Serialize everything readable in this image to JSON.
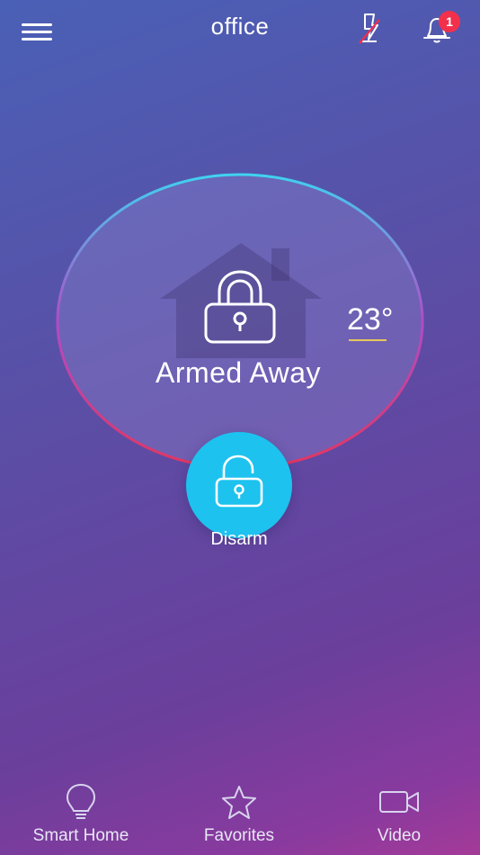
{
  "header": {
    "title": "office",
    "menu_icon": "hamburger-icon",
    "panic_icon": "lightning-icon",
    "notifications_icon": "bell-icon",
    "notification_count": "1"
  },
  "status": {
    "state": "Armed Away",
    "temperature": "23°",
    "colors": {
      "ring_top": "#3fd3f0",
      "ring_bottom": "#e3365f",
      "accent": "#1ec2ef",
      "badge": "#f2304b"
    }
  },
  "action": {
    "label": "Disarm",
    "icon": "unlocked-padlock-icon"
  },
  "bottom_nav": {
    "items": [
      {
        "label": "Smart Home",
        "icon": "lightbulb-icon"
      },
      {
        "label": "Favorites",
        "icon": "star-icon"
      },
      {
        "label": "Video",
        "icon": "video-camera-icon"
      }
    ]
  }
}
